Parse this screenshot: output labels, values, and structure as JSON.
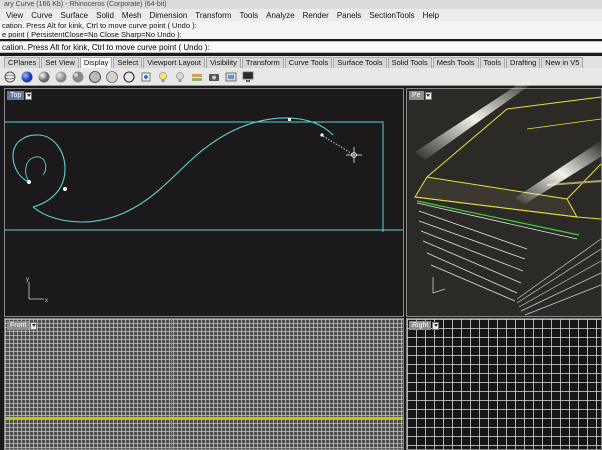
{
  "window": {
    "title": "ary Curve (166 Kb) - Rhinoceros (Corporate) (64-bit)"
  },
  "menu": {
    "items": [
      "View",
      "Curve",
      "Surface",
      "Solid",
      "Mesh",
      "Dimension",
      "Transform",
      "Tools",
      "Analyze",
      "Render",
      "Panels",
      "SectionTools",
      "Help"
    ]
  },
  "command_history": {
    "line1": "cation. Press Alt for kink, Ctrl to move curve point ( Undo ):",
    "line2": "e point ( PersistentClose=No  Close  Sharp=No  Undo ):"
  },
  "command_prompt": {
    "text": "cation. Press Alt for kink, Ctrl to move curve point ( Undo ):"
  },
  "toolbar_tabs": [
    {
      "label": "CPlanes",
      "active": false
    },
    {
      "label": "Set View",
      "active": false
    },
    {
      "label": "Display",
      "active": true
    },
    {
      "label": "Select",
      "active": false
    },
    {
      "label": "Viewport Layout",
      "active": false
    },
    {
      "label": "Visibility",
      "active": false
    },
    {
      "label": "Transform",
      "active": false
    },
    {
      "label": "Curve Tools",
      "active": false
    },
    {
      "label": "Surface Tools",
      "active": false
    },
    {
      "label": "Solid Tools",
      "active": false
    },
    {
      "label": "Mesh Tools",
      "active": false
    },
    {
      "label": "Tools",
      "active": false
    },
    {
      "label": "Drafting",
      "active": false
    },
    {
      "label": "New in V5",
      "active": false
    }
  ],
  "display_toolbar": {
    "icons": [
      "wireframe-sphere-icon",
      "shaded-sphere-icon",
      "rendered-sphere-icon",
      "ghosted-sphere-icon",
      "xray-sphere-icon",
      "technical-sphere-icon",
      "artistic-sphere-icon",
      "pen-sphere-icon",
      "object-properties-icon",
      "light-bulb-icon",
      "light-bulb-off-icon",
      "layer-state-icon",
      "camera-icon",
      "viewport-capture-icon",
      "monitor-icon"
    ]
  },
  "viewports": {
    "top": {
      "label": "Top",
      "axis_y": "y",
      "axis_x": "x"
    },
    "perspective": {
      "label": "Pe"
    },
    "front": {
      "label": "Front"
    },
    "right": {
      "label": "Right"
    }
  },
  "colors": {
    "curve": "#5fd3d3",
    "wireframe_yellow": "#e8e23c",
    "x_axis": "#c9c11c",
    "y_axis": "#2ec12e",
    "active_label": "#5c7aa3"
  }
}
